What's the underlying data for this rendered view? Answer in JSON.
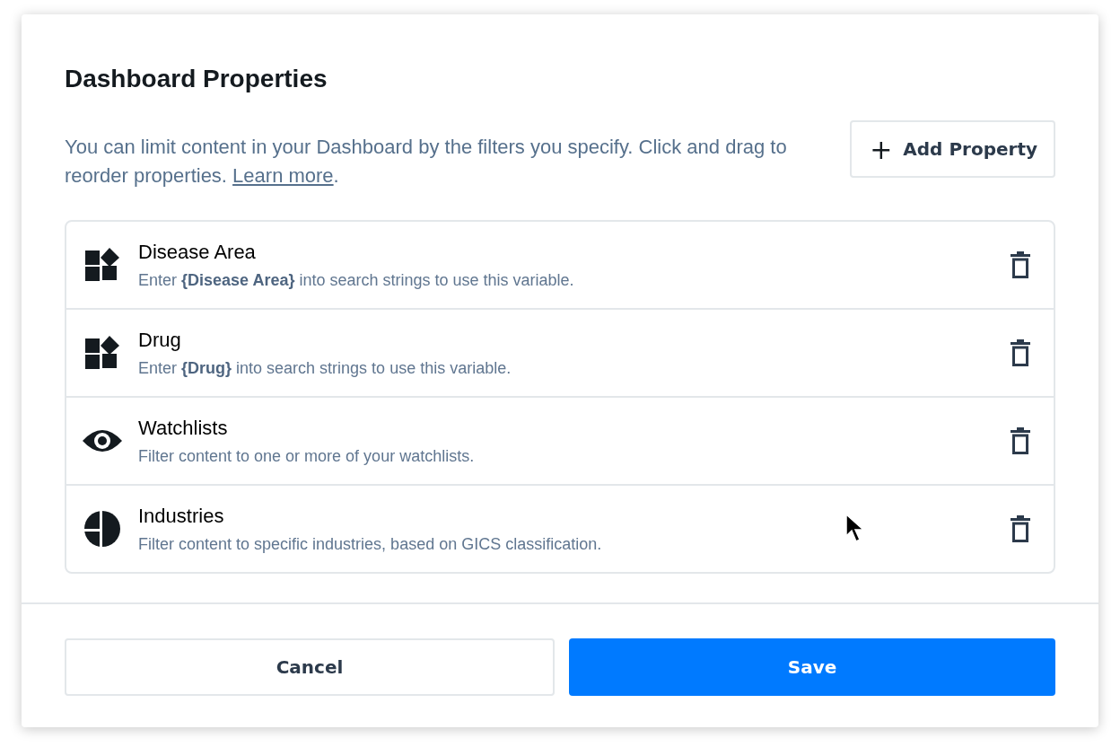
{
  "dialog": {
    "title": "Dashboard Properties",
    "description": "You can limit content in your Dashboard by the filters you specify. Click and drag to reorder properties.",
    "learn_more_link": "Learn more",
    "description_end": ".",
    "add_button": {
      "icon": "+",
      "label": "Add Property"
    },
    "properties": [
      {
        "kind": "shapes",
        "name": "Disease Area",
        "hint": "Enter **{Disease Area}** into search strings to use this variable."
      },
      {
        "kind": "shapes",
        "name": "Drug",
        "hint": "Enter **{Drug}** into search strings to use this variable."
      },
      {
        "kind": "eye",
        "name": "Watchlists",
        "hint": "Filter content to one or more of your watchlists."
      },
      {
        "kind": "globe",
        "name": "Industries",
        "hint": "Filter content to specific industries, based on GICS classification."
      }
    ],
    "buttons": [
      {
        "kind": "secondary",
        "label": "Cancel"
      },
      {
        "kind": "primary",
        "label": "Save"
      }
    ]
  }
}
